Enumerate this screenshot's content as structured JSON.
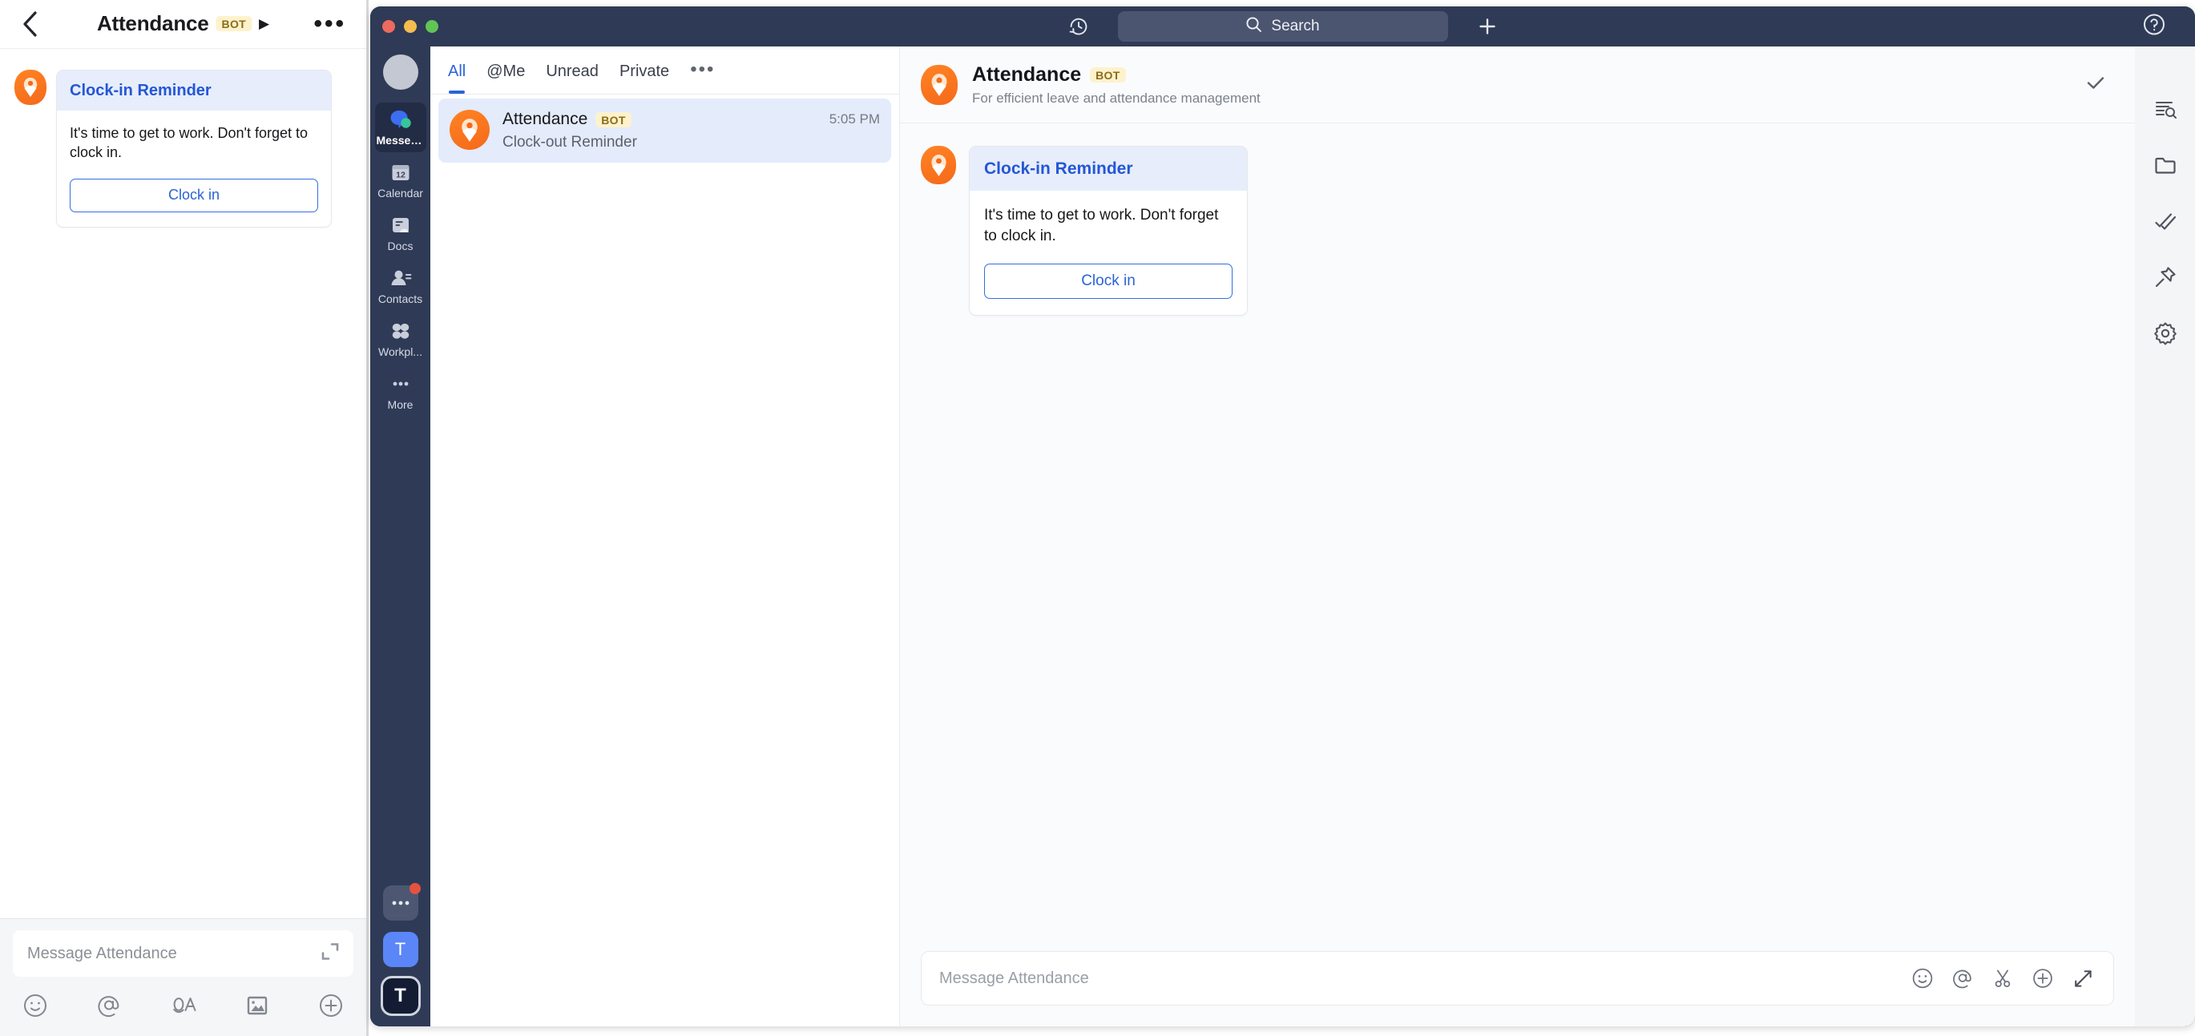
{
  "colors": {
    "brand_orange": "#f5691a",
    "accent_blue": "#2457d6",
    "bot_badge_bg": "#fdf2cd",
    "bot_badge_fg": "#8a6d16",
    "window_chrome": "#2f3a56",
    "selected_chat": "#e4ebfb",
    "card_header": "#e7edfb"
  },
  "mobile": {
    "header": {
      "back_icon": "chevron-left-icon",
      "title": "Attendance",
      "badge": "BOT",
      "play_icon": "▶",
      "more_icon": "•••"
    },
    "message": {
      "avatar": "attendance-bot-avatar",
      "card": {
        "title": "Clock-in Reminder",
        "body": "It's time to get to work. Don't forget to clock in.",
        "button": "Clock in"
      }
    },
    "composer": {
      "placeholder": "Message Attendance",
      "expand_icon": "expand-icon",
      "toolbar": [
        {
          "name": "emoji-icon"
        },
        {
          "name": "mention-icon"
        },
        {
          "name": "voice-to-text-icon"
        },
        {
          "name": "image-icon"
        },
        {
          "name": "add-icon"
        }
      ]
    }
  },
  "desktop": {
    "titlebar": {
      "traffic_lights": [
        "close",
        "minimize",
        "maximize"
      ],
      "history_icon": "history-icon",
      "search_placeholder": "Search",
      "search_icon": "search-icon",
      "add_icon": "plus-icon",
      "help_icon": "help-icon"
    },
    "rail": {
      "avatar": "user-avatar",
      "items": [
        {
          "label": "Messen...",
          "icon": "messenger-icon",
          "active": true
        },
        {
          "label": "Calendar",
          "icon": "calendar-icon",
          "active": false
        },
        {
          "label": "Docs",
          "icon": "docs-icon",
          "active": false
        },
        {
          "label": "Contacts",
          "icon": "contacts-icon",
          "active": false
        },
        {
          "label": "Workpl...",
          "icon": "workplace-icon",
          "active": false
        },
        {
          "label": "More",
          "icon": "more-icon",
          "active": false
        }
      ],
      "bottom": [
        {
          "name": "more-apps-button",
          "label": "•••",
          "badge": true
        },
        {
          "name": "tenant-button-1",
          "label": "T"
        },
        {
          "name": "tenant-button-2",
          "label": "T"
        }
      ]
    },
    "chat_list": {
      "tabs": [
        {
          "label": "All",
          "active": true
        },
        {
          "label": "@Me",
          "active": false
        },
        {
          "label": "Unread",
          "active": false
        },
        {
          "label": "Private",
          "active": false
        }
      ],
      "tabs_more": "•••",
      "items": [
        {
          "avatar": "attendance-bot-avatar",
          "name": "Attendance",
          "badge": "BOT",
          "time": "5:05 PM",
          "preview": "Clock-out Reminder",
          "selected": true
        }
      ]
    },
    "conversation": {
      "header": {
        "avatar": "attendance-bot-avatar",
        "name": "Attendance",
        "badge": "BOT",
        "subtitle": "For efficient leave and attendance management",
        "check_icon": "check-icon"
      },
      "message": {
        "avatar": "attendance-bot-avatar",
        "card": {
          "title": "Clock-in Reminder",
          "body": "It's time to get to work. Don't forget to clock in.",
          "button": "Clock in"
        }
      },
      "composer": {
        "placeholder": "Message Attendance",
        "icons": [
          {
            "name": "emoji-icon"
          },
          {
            "name": "mention-icon"
          },
          {
            "name": "scissors-icon"
          },
          {
            "name": "add-icon"
          },
          {
            "name": "expand-icon"
          }
        ]
      }
    },
    "right_rail": [
      {
        "name": "search-in-chat-icon"
      },
      {
        "name": "folder-icon"
      },
      {
        "name": "tasks-icon"
      },
      {
        "name": "pin-icon"
      },
      {
        "name": "settings-icon"
      }
    ]
  }
}
